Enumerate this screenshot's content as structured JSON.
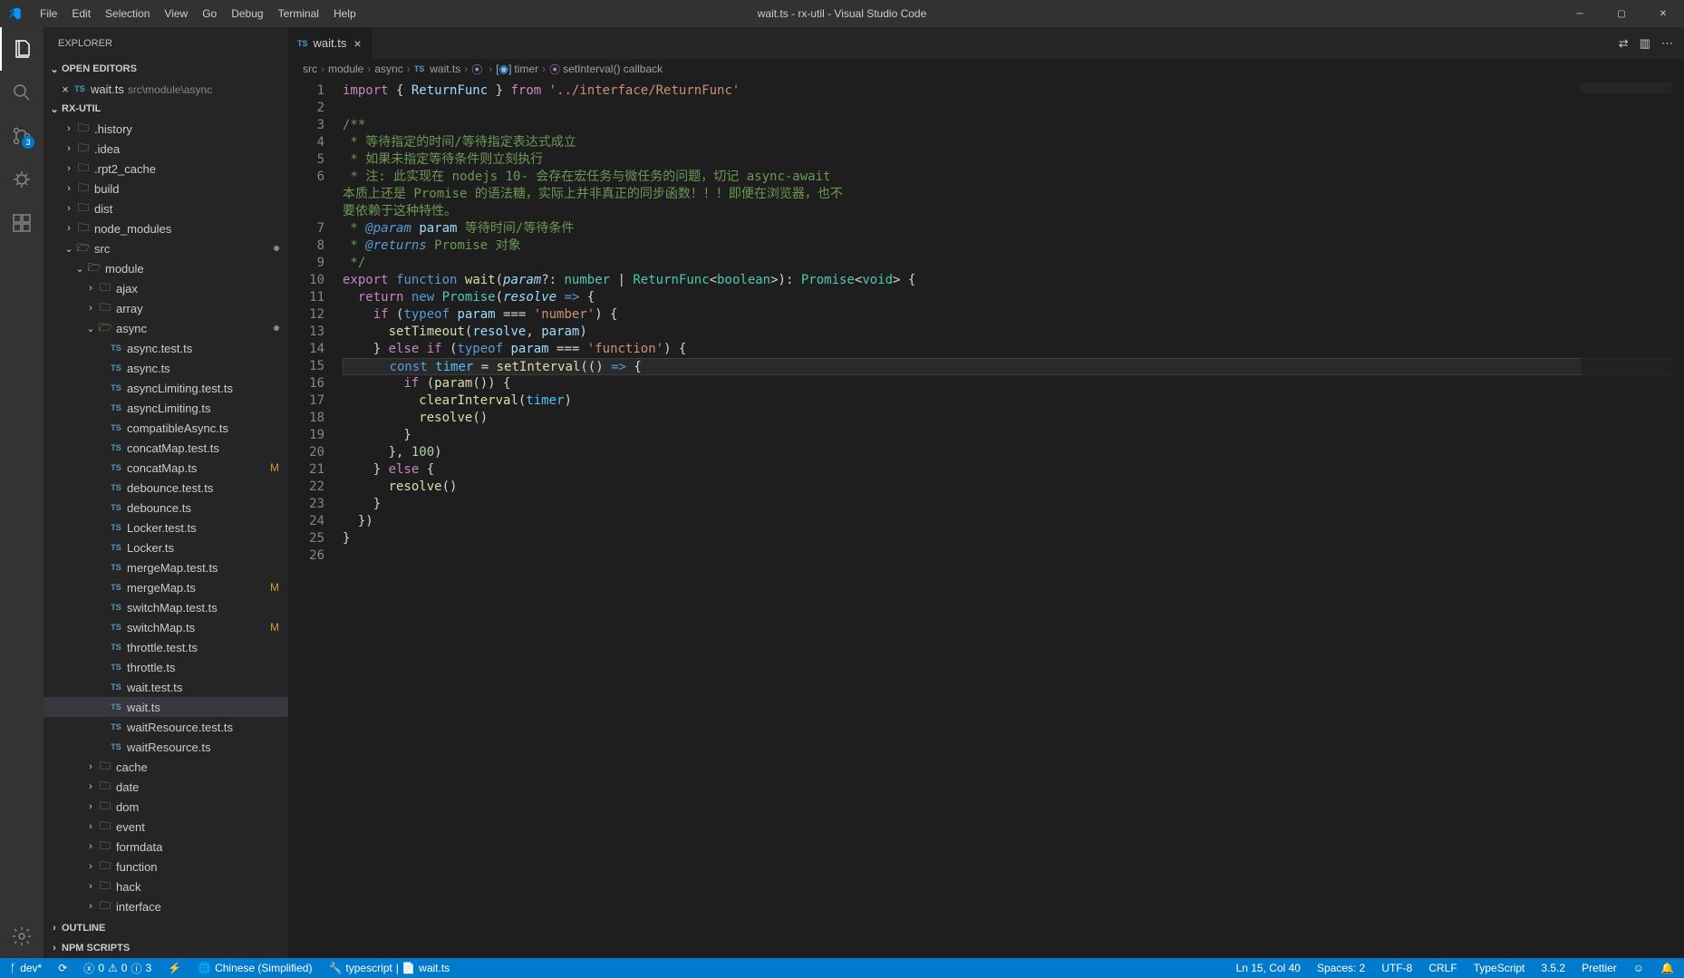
{
  "window_title": "wait.ts - rx-util - Visual Studio Code",
  "menu": [
    "File",
    "Edit",
    "Selection",
    "View",
    "Go",
    "Debug",
    "Terminal",
    "Help"
  ],
  "sidebar": {
    "title": "EXPLORER",
    "open_editors_label": "OPEN EDITORS",
    "project_label": "RX-UTIL",
    "outline_label": "OUTLINE",
    "npm_scripts_label": "NPM SCRIPTS",
    "open_editor": {
      "name": "wait.ts",
      "path": "src\\module\\async"
    },
    "tree": [
      {
        "d": 1,
        "t": "folder",
        "n": ".history",
        "c": true
      },
      {
        "d": 1,
        "t": "folder",
        "n": ".idea",
        "c": true
      },
      {
        "d": 1,
        "t": "folder",
        "n": ".rpt2_cache",
        "c": true
      },
      {
        "d": 1,
        "t": "folder",
        "n": "build",
        "c": true
      },
      {
        "d": 1,
        "t": "folder",
        "n": "dist",
        "c": true
      },
      {
        "d": 1,
        "t": "folder",
        "n": "node_modules",
        "c": true
      },
      {
        "d": 1,
        "t": "folder",
        "n": "src",
        "c": false,
        "dot": true
      },
      {
        "d": 2,
        "t": "folder",
        "n": "module",
        "c": false
      },
      {
        "d": 3,
        "t": "folder",
        "n": "ajax",
        "c": true
      },
      {
        "d": 3,
        "t": "folder",
        "n": "array",
        "c": true
      },
      {
        "d": 3,
        "t": "folder",
        "n": "async",
        "c": false,
        "dot": true
      },
      {
        "d": 4,
        "t": "ts",
        "n": "async.test.ts"
      },
      {
        "d": 4,
        "t": "ts",
        "n": "async.ts"
      },
      {
        "d": 4,
        "t": "ts",
        "n": "asyncLimiting.test.ts"
      },
      {
        "d": 4,
        "t": "ts",
        "n": "asyncLimiting.ts"
      },
      {
        "d": 4,
        "t": "ts",
        "n": "compatibleAsync.ts"
      },
      {
        "d": 4,
        "t": "ts",
        "n": "concatMap.test.ts"
      },
      {
        "d": 4,
        "t": "ts",
        "n": "concatMap.ts",
        "m": "M"
      },
      {
        "d": 4,
        "t": "ts",
        "n": "debounce.test.ts"
      },
      {
        "d": 4,
        "t": "ts",
        "n": "debounce.ts"
      },
      {
        "d": 4,
        "t": "ts",
        "n": "Locker.test.ts"
      },
      {
        "d": 4,
        "t": "ts",
        "n": "Locker.ts"
      },
      {
        "d": 4,
        "t": "ts",
        "n": "mergeMap.test.ts"
      },
      {
        "d": 4,
        "t": "ts",
        "n": "mergeMap.ts",
        "m": "M"
      },
      {
        "d": 4,
        "t": "ts",
        "n": "switchMap.test.ts"
      },
      {
        "d": 4,
        "t": "ts",
        "n": "switchMap.ts",
        "m": "M"
      },
      {
        "d": 4,
        "t": "ts",
        "n": "throttle.test.ts"
      },
      {
        "d": 4,
        "t": "ts",
        "n": "throttle.ts"
      },
      {
        "d": 4,
        "t": "ts",
        "n": "wait.test.ts"
      },
      {
        "d": 4,
        "t": "ts",
        "n": "wait.ts",
        "active": true
      },
      {
        "d": 4,
        "t": "ts",
        "n": "waitResource.test.ts"
      },
      {
        "d": 4,
        "t": "ts",
        "n": "waitResource.ts"
      },
      {
        "d": 3,
        "t": "folder",
        "n": "cache",
        "c": true
      },
      {
        "d": 3,
        "t": "folder",
        "n": "date",
        "c": true
      },
      {
        "d": 3,
        "t": "folder",
        "n": "dom",
        "c": true
      },
      {
        "d": 3,
        "t": "folder",
        "n": "event",
        "c": true
      },
      {
        "d": 3,
        "t": "folder",
        "n": "formdata",
        "c": true
      },
      {
        "d": 3,
        "t": "folder",
        "n": "function",
        "c": true
      },
      {
        "d": 3,
        "t": "folder",
        "n": "hack",
        "c": true
      },
      {
        "d": 3,
        "t": "folder",
        "n": "interface",
        "c": true
      }
    ]
  },
  "activity_badge": "3",
  "tab": {
    "name": "wait.ts"
  },
  "breadcrumbs": [
    "src",
    "module",
    "async",
    "wait.ts",
    "<function>",
    "timer",
    "setInterval() callback"
  ],
  "code_lines": [
    {
      "n": 1,
      "html": "<span class='k-keyword'>import</span> { <span class='k-var'>ReturnFunc</span> } <span class='k-keyword'>from</span> <span class='k-string'>'../interface/ReturnFunc'</span>"
    },
    {
      "n": 2,
      "html": ""
    },
    {
      "n": 3,
      "html": "<span class='k-comment'>/**</span>"
    },
    {
      "n": 4,
      "html": "<span class='k-comment'> * 等待指定的时间/等待指定表达式成立</span>"
    },
    {
      "n": 5,
      "html": "<span class='k-comment'> * 如果未指定等待条件则立刻执行</span>"
    },
    {
      "n": 6,
      "html": "<span class='k-comment'> * 注: 此实现在 nodejs 10- 会存在宏任务与微任务的问题，切记 async-await 本质上还是 Promise 的语法糖，实际上并非真正的同步函数！！！即便在浏览器，也不要依赖于这种特性。</span>",
      "wrap": true
    },
    {
      "n": 7,
      "html": "<span class='k-comment'> * <span class='k-doctag'>@param</span> <span class='k-var'>param</span> 等待时间/等待条件</span>"
    },
    {
      "n": 8,
      "html": "<span class='k-comment'> * <span class='k-doctag'>@returns</span> Promise 对象</span>"
    },
    {
      "n": 9,
      "html": "<span class='k-comment'> */</span>"
    },
    {
      "n": 10,
      "html": "<span class='k-keyword'>export</span> <span class='k-storage'>function</span> <span class='k-func'>wait</span>(<span class='k-param'>param</span><span class='k-op'>?:</span> <span class='k-type'>number</span> | <span class='k-type'>ReturnFunc</span>&lt;<span class='k-type'>boolean</span>&gt;)<span class='k-op'>:</span> <span class='k-type'>Promise</span>&lt;<span class='k-type'>void</span>&gt; {"
    },
    {
      "n": 11,
      "html": "  <span class='k-keyword'>return</span> <span class='k-storage'>new</span> <span class='k-type'>Promise</span>(<span class='k-param'>resolve</span> <span class='k-storage'>=&gt;</span> {"
    },
    {
      "n": 12,
      "html": "    <span class='k-keyword'>if</span> (<span class='k-storage'>typeof</span> <span class='k-var'>param</span> === <span class='k-string'>'number'</span>) {"
    },
    {
      "n": 13,
      "html": "      <span class='k-func'>setTimeout</span>(<span class='k-var'>resolve</span>, <span class='k-var'>param</span>)"
    },
    {
      "n": 14,
      "html": "    } <span class='k-keyword'>else if</span> (<span class='k-storage'>typeof</span> <span class='k-var'>param</span> === <span class='k-string'>'function'</span>) {"
    },
    {
      "n": 15,
      "html": "      <span class='k-storage'>const</span> <span class='k-const'>timer</span> = <span class='k-func'>setInterval</span>(() <span class='k-storage'>=&gt;</span> {",
      "hl": true
    },
    {
      "n": 16,
      "html": "        <span class='k-keyword'>if</span> (<span class='k-func'>param</span>()) {"
    },
    {
      "n": 17,
      "html": "          <span class='k-func'>clearInterval</span>(<span class='k-const'>timer</span>)"
    },
    {
      "n": 18,
      "html": "          <span class='k-func'>resolve</span>()"
    },
    {
      "n": 19,
      "html": "        }"
    },
    {
      "n": 20,
      "html": "      }, <span class='k-num'>100</span>)"
    },
    {
      "n": 21,
      "html": "    } <span class='k-keyword'>else</span> {"
    },
    {
      "n": 22,
      "html": "      <span class='k-func'>resolve</span>()"
    },
    {
      "n": 23,
      "html": "    }"
    },
    {
      "n": 24,
      "html": "  })"
    },
    {
      "n": 25,
      "html": "}"
    },
    {
      "n": 26,
      "html": ""
    }
  ],
  "status": {
    "branch": "dev*",
    "sync": "",
    "errors": "0",
    "warnings": "0",
    "info": "3",
    "live": "",
    "lang_loc": "Chinese (Simplified)",
    "tslabel": "typescript",
    "tsfile": "wait.ts",
    "ln_col": "Ln 15, Col 40",
    "spaces": "Spaces: 2",
    "encoding": "UTF-8",
    "eol": "CRLF",
    "language": "TypeScript",
    "tsver": "3.5.2",
    "prettier": "Prettier",
    "feedback": "",
    "bell": ""
  }
}
